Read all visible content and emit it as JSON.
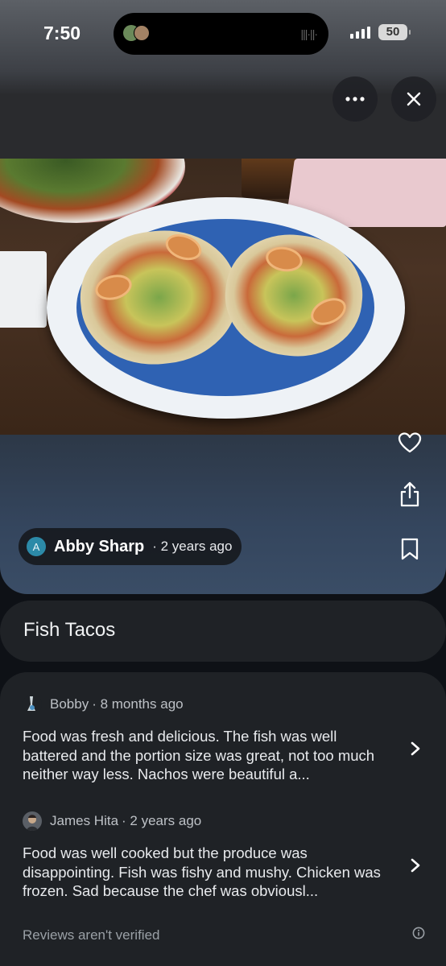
{
  "status_bar": {
    "time": "7:50",
    "battery": "50"
  },
  "header": {
    "more_icon": "more-horizontal-icon",
    "close_icon": "close-icon"
  },
  "photo": {
    "subject": "fish-tacos-photo"
  },
  "actions": {
    "like_icon": "heart-icon",
    "share_icon": "share-icon",
    "save_icon": "bookmark-icon"
  },
  "author": {
    "initial": "A",
    "name": "Abby Sharp",
    "time": "· 2 years ago",
    "avatar_color": "#2c8aa8"
  },
  "dish": {
    "title": "Fish Tacos"
  },
  "reviews": [
    {
      "name": "Bobby",
      "time": "· 8 months ago",
      "text": "Food was fresh and delicious. The fish was well battered and the portion size was great, not too much neither way less. Nachos were beautiful a..."
    },
    {
      "name": "James Hita",
      "time": "· 2 years ago",
      "text": "Food was well cooked but the produce was disappointing. Fish was fishy and mushy. Chicken was frozen. Sad because the chef was obviousl..."
    }
  ],
  "footer": {
    "note": "Reviews aren't verified",
    "info_icon": "info-icon"
  }
}
